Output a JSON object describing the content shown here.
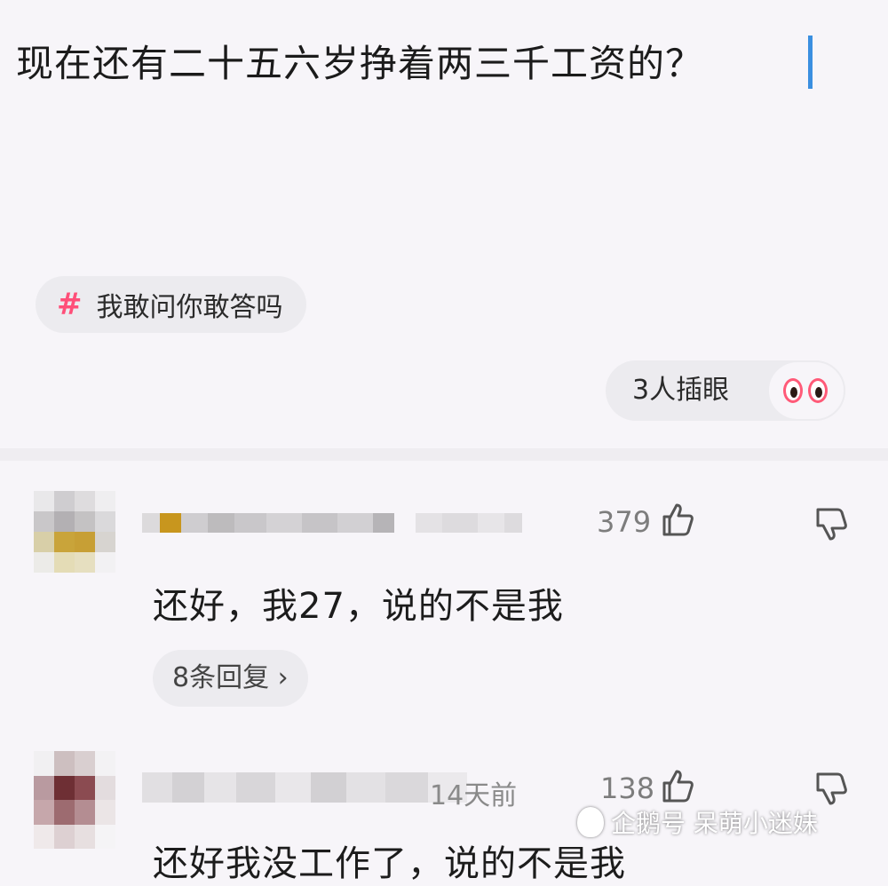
{
  "post": {
    "question": "现在还有二十五六岁挣着两三千工资的？",
    "topic_tag": "我敢问你敢答吗",
    "topic_icon": "hash-icon",
    "peek_label": "3人插眼",
    "peek_icon": "eyes-icon"
  },
  "comments": [
    {
      "time": "",
      "likes": "379",
      "text": "还好，我27，说的不是我",
      "reply_label": "8条回复 ›"
    },
    {
      "time": "14天前",
      "likes": "138",
      "text": "还好我没工作了，说的不是我"
    }
  ],
  "watermark": {
    "text": "企鹅号 呆萌小迷妹"
  },
  "colors": {
    "accent_cursor": "#3a8fe0",
    "topic_hash": "#ff4f79",
    "background": "#f7f5f9"
  }
}
